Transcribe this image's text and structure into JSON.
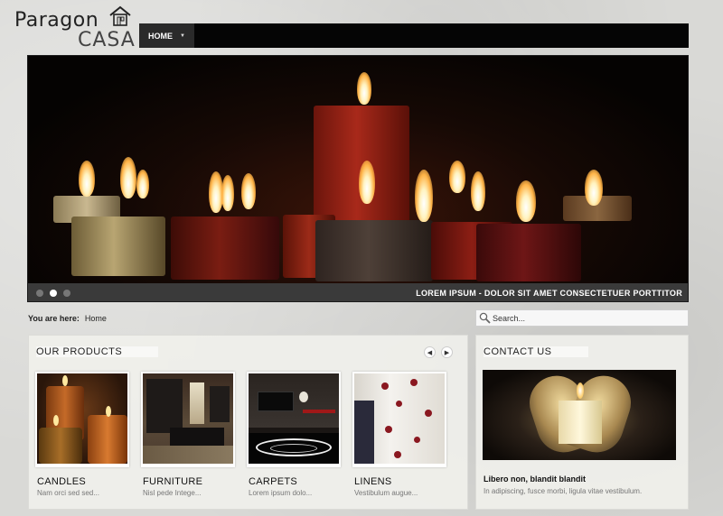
{
  "logo": {
    "word1": "Paragon",
    "word2": "CASA"
  },
  "nav": {
    "items": [
      {
        "label": "HOME"
      }
    ]
  },
  "slider": {
    "caption": "LOREM IPSUM - DOLOR SIT AMET CONSECTETUER PORTTITOR",
    "dots": 3,
    "active_dot": 2
  },
  "breadcrumb": {
    "label": "You are here:",
    "current": "Home"
  },
  "search": {
    "placeholder": "Search..."
  },
  "products": {
    "title": "OUR PRODUCTS",
    "prev_icon": "chevron-left-icon",
    "next_icon": "chevron-right-icon",
    "items": [
      {
        "name": "CANDLES",
        "desc": "Nam orci sed sed..."
      },
      {
        "name": "FURNITURE",
        "desc": "Nisl pede Intege..."
      },
      {
        "name": "CARPETS",
        "desc": "Lorem ipsum dolo..."
      },
      {
        "name": "LINENS",
        "desc": "Vestibulum augue..."
      }
    ]
  },
  "contact": {
    "title": "CONTACT US",
    "heading": "Libero non, blandit blandit",
    "text": "In adipiscing, fusce morbi, ligula vitae vestibulum."
  },
  "colors": {
    "navbar": "#050505",
    "slider_bar": "#3a3a3a",
    "panel": "#f0f0ec"
  }
}
